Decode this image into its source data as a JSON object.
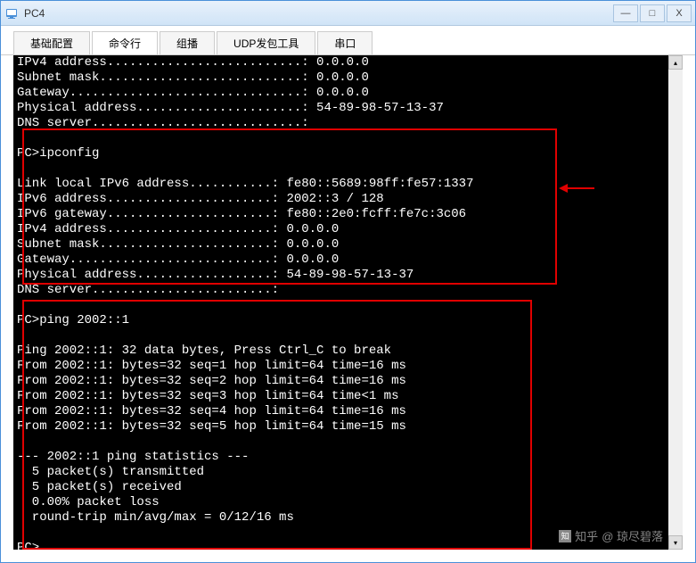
{
  "window": {
    "title": "PC4"
  },
  "tabs": {
    "items": [
      {
        "label": "基础配置"
      },
      {
        "label": "命令行"
      },
      {
        "label": "组播"
      },
      {
        "label": "UDP发包工具"
      },
      {
        "label": "串口"
      }
    ]
  },
  "terminal": {
    "lines": [
      "IPv4 address..........................: 0.0.0.0",
      "Subnet mask...........................: 0.0.0.0",
      "Gateway...............................: 0.0.0.0",
      "Physical address......................: 54-89-98-57-13-37",
      "DNS server............................:",
      "",
      "PC>ipconfig",
      "",
      "Link local IPv6 address...........: fe80::5689:98ff:fe57:1337",
      "IPv6 address......................: 2002::3 / 128",
      "IPv6 gateway......................: fe80::2e0:fcff:fe7c:3c06",
      "IPv4 address......................: 0.0.0.0",
      "Subnet mask.......................: 0.0.0.0",
      "Gateway...........................: 0.0.0.0",
      "Physical address..................: 54-89-98-57-13-37",
      "DNS server........................:",
      "",
      "PC>ping 2002::1",
      "",
      "Ping 2002::1: 32 data bytes, Press Ctrl_C to break",
      "From 2002::1: bytes=32 seq=1 hop limit=64 time=16 ms",
      "From 2002::1: bytes=32 seq=2 hop limit=64 time=16 ms",
      "From 2002::1: bytes=32 seq=3 hop limit=64 time<1 ms",
      "From 2002::1: bytes=32 seq=4 hop limit=64 time=16 ms",
      "From 2002::1: bytes=32 seq=5 hop limit=64 time=15 ms",
      "",
      "--- 2002::1 ping statistics ---",
      "  5 packet(s) transmitted",
      "  5 packet(s) received",
      "  0.00% packet loss",
      "  round-trip min/avg/max = 0/12/16 ms",
      "",
      "PC>"
    ]
  },
  "watermark": {
    "brand": "知乎",
    "user": "@ 琼尽碧落"
  }
}
